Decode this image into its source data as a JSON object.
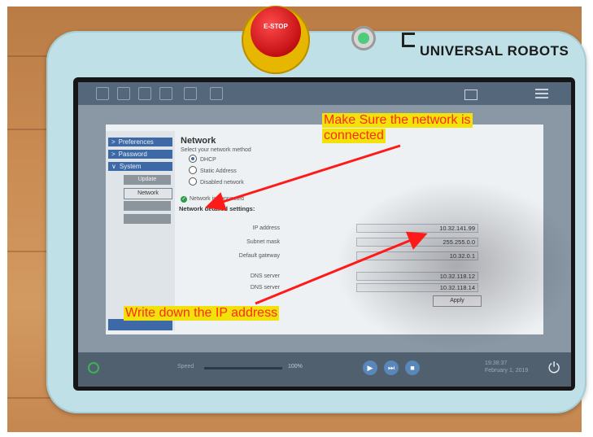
{
  "pendant": {
    "estop_label": "E-STOP",
    "brand_name": "UNIVERSAL ROBOTS"
  },
  "screen": {
    "sidebar": {
      "items": [
        {
          "label": "Preferences",
          "chevron": ">"
        },
        {
          "label": "Password",
          "chevron": ">"
        },
        {
          "label": "System",
          "chevron": "∨"
        }
      ],
      "sub_items": [
        {
          "label": "Update",
          "active": false
        },
        {
          "label": "Network",
          "active": true
        },
        {
          "label": "",
          "active": false
        },
        {
          "label": "",
          "active": false
        }
      ]
    },
    "network": {
      "title": "Network",
      "subtitle": "Select your network method",
      "methods": [
        {
          "label": "DHCP",
          "selected": true
        },
        {
          "label": "Static Address",
          "selected": false
        },
        {
          "label": "Disabled network",
          "selected": false
        }
      ],
      "status": "Network is connected",
      "details_title": "Network detailed settings:",
      "fields": [
        {
          "label": "IP address",
          "value": "10.32.141.99"
        },
        {
          "label": "Subnet mask",
          "value": "255.255.0.0"
        },
        {
          "label": "Default gateway",
          "value": "10.32.0.1"
        },
        {
          "label": "DNS server",
          "value": "10.32.118.12"
        },
        {
          "label": "DNS server",
          "value": "10.32.118.14"
        }
      ],
      "apply_label": "Apply"
    },
    "bottombar": {
      "speed_label": "Speed",
      "speed_value": "100%",
      "time": "19:38:37",
      "date": "February 1, 2019"
    }
  },
  "annotations": {
    "top": "Make Sure the  network is connected",
    "top_line1": "Make Sure the  network is",
    "top_line2": "connected",
    "bottom": "Write down the IP address"
  },
  "colors": {
    "annotation_text": "#ff2a1a",
    "annotation_bg": "#f3e10a",
    "arrow": "#ff1a1a",
    "ur_blue": "#3d6aa6"
  }
}
